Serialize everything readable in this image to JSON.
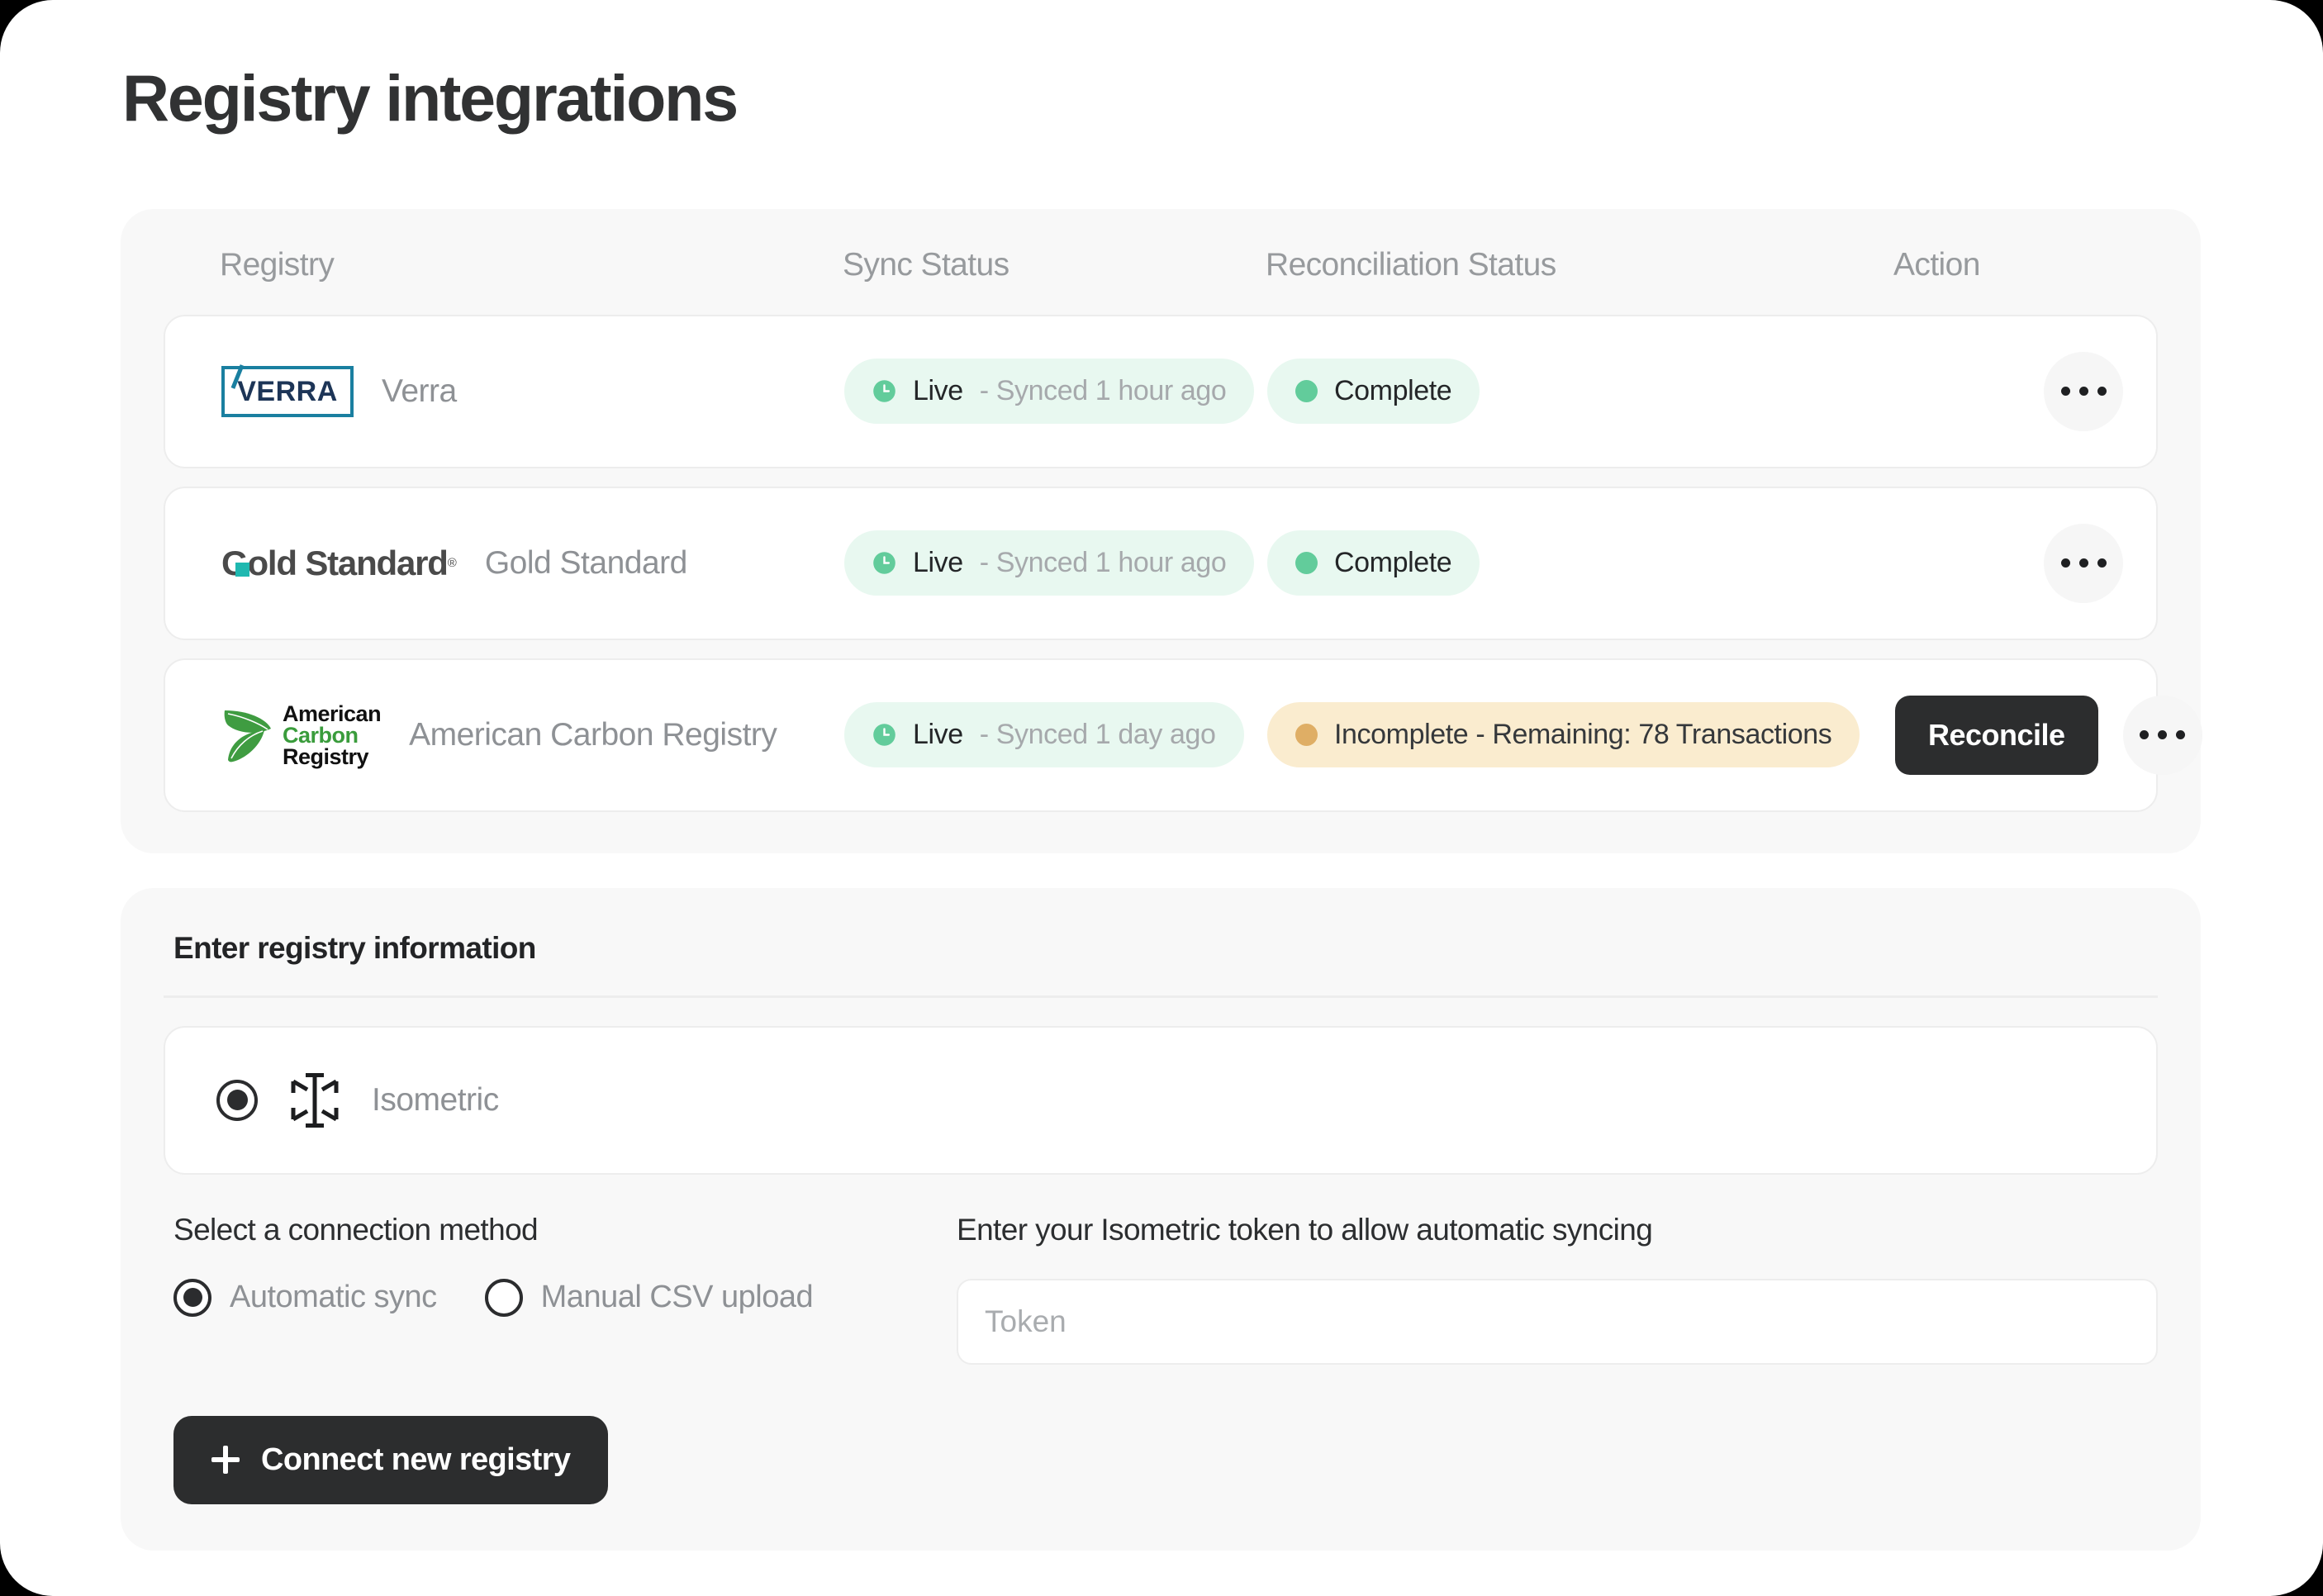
{
  "page": {
    "title": "Registry integrations"
  },
  "table": {
    "columns": [
      {
        "id": "registry",
        "label": "Registry"
      },
      {
        "id": "sync_status",
        "label": "Sync Status"
      },
      {
        "id": "reconciliation_status",
        "label": "Reconciliation Status"
      },
      {
        "id": "action",
        "label": "Action"
      }
    ],
    "rows": [
      {
        "logo": "verra-logo",
        "logo_text": "VERRA",
        "registry": "Verra",
        "sync": {
          "icon": "clock-icon",
          "state": "Live",
          "detail": "- Synced 1 hour ago",
          "tone": "green"
        },
        "reconciliation": {
          "icon": "status-dot",
          "label": "Complete",
          "tone": "green"
        },
        "action_button": null,
        "menu_icon": "kebab-menu-icon"
      },
      {
        "logo": "gold-standard-logo",
        "logo_text": "Gold Standard",
        "registry": "Gold Standard",
        "sync": {
          "icon": "clock-icon",
          "state": "Live",
          "detail": "- Synced 1 hour ago",
          "tone": "green"
        },
        "reconciliation": {
          "icon": "status-dot",
          "label": "Complete",
          "tone": "green"
        },
        "action_button": null,
        "menu_icon": "kebab-menu-icon"
      },
      {
        "logo": "american-carbon-registry-logo",
        "logo_text_line1": "American",
        "logo_text_line2": "Carbon",
        "logo_text_line3": "Registry",
        "registry": "American Carbon Registry",
        "sync": {
          "icon": "clock-icon",
          "state": "Live",
          "detail": "- Synced 1 day ago",
          "tone": "green"
        },
        "reconciliation": {
          "icon": "status-dot",
          "label": "Incomplete - Remaining: 78 Transactions",
          "tone": "amber"
        },
        "action_button": "Reconcile",
        "menu_icon": "kebab-menu-icon"
      }
    ]
  },
  "form": {
    "title": "Enter registry information",
    "selected_registry": {
      "label": "Isometric",
      "icon": "isometric-logo-icon",
      "selected": true
    },
    "connection_method": {
      "label": "Select a connection method",
      "options": [
        {
          "label": "Automatic sync",
          "selected": true
        },
        {
          "label": "Manual CSV upload",
          "selected": false
        }
      ]
    },
    "token": {
      "label": "Enter your Isometric token to allow automatic syncing",
      "placeholder": "Token",
      "value": ""
    },
    "connect_button": {
      "label": "Connect new registry",
      "icon": "plus-icon"
    }
  },
  "colors": {
    "accent_dark": "#2c2d2e",
    "green_badge_bg": "#e8f8f0",
    "green_dot": "#62cc9b",
    "amber_badge_bg": "#faeccf",
    "amber_dot": "#dfae65",
    "card_bg": "#f8f8f8",
    "muted_text": "#8e9195"
  }
}
